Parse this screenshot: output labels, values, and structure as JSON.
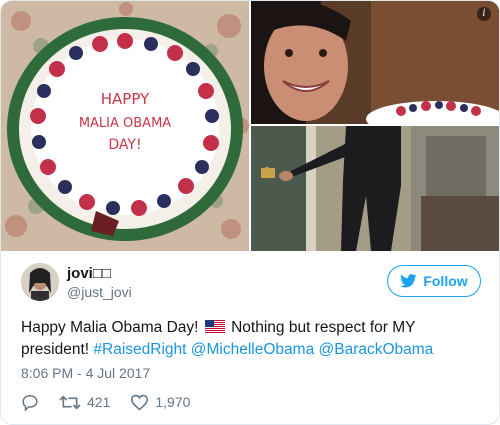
{
  "media": {
    "cake_text": [
      "HAPPY",
      "MALIA OBAMA",
      "DAY!"
    ]
  },
  "user": {
    "display_name": "jovi",
    "display_name_suffix": "□□",
    "handle": "@just_jovi"
  },
  "follow_button": {
    "label": "Follow"
  },
  "tweet": {
    "text_before_flag": "Happy Malia Obama Day!",
    "text_after_flag": "Nothing but respect for MY president!",
    "hashtag": "#RaisedRight",
    "mention_1": "@MichelleObama",
    "mention_2": "@BarackObama"
  },
  "timestamp": "8:06 PM - 4 Jul 2017",
  "actions": {
    "retweet_count": "421",
    "like_count": "1,970"
  },
  "colors": {
    "link": "#1b95e0",
    "follow": "#1da1f2",
    "muted": "#657786"
  },
  "icons": [
    "info-icon",
    "twitter-bird-icon",
    "reply-icon",
    "retweet-icon",
    "heart-icon",
    "us-flag-icon"
  ]
}
